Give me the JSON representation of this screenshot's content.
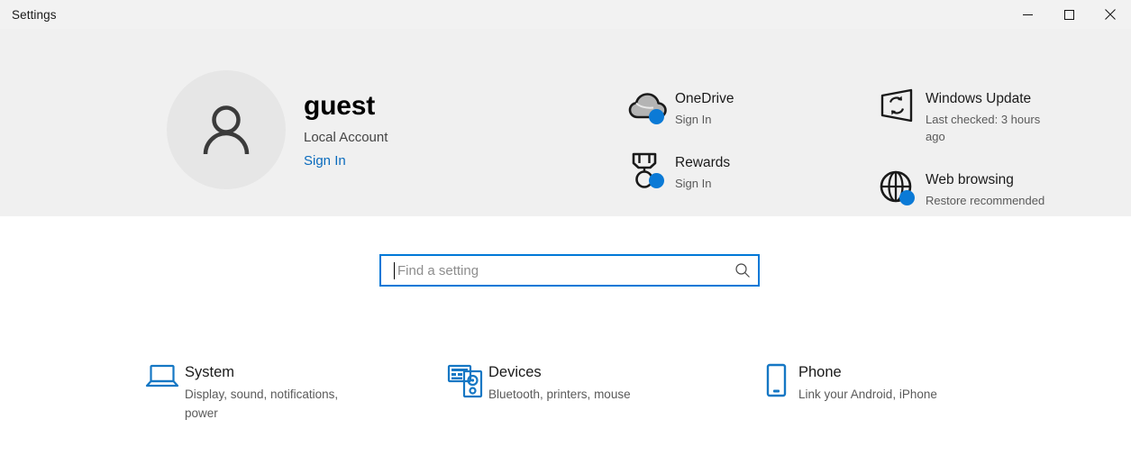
{
  "window": {
    "title": "Settings",
    "controls": [
      {
        "name": "minimize",
        "glyph": "minimize-icon"
      },
      {
        "name": "maximize",
        "glyph": "maximize-icon"
      },
      {
        "name": "close",
        "glyph": "close-icon"
      }
    ]
  },
  "account": {
    "avatar_icon": "person-icon",
    "name": "guest",
    "type": "Local Account",
    "sign_in_label": "Sign In"
  },
  "status_columns": [
    {
      "items": [
        {
          "icon": "onedrive-cloud-icon",
          "title": "OneDrive",
          "subtitle": "Sign In"
        },
        {
          "icon": "rewards-medal-icon",
          "title": "Rewards",
          "subtitle": "Sign In"
        }
      ]
    },
    {
      "items": [
        {
          "icon": "windows-update-icon",
          "title": "Windows Update",
          "subtitle": "Last checked: 3 hours ago"
        },
        {
          "icon": "web-browsing-globe-icon",
          "title": "Web browsing",
          "subtitle": "Restore recommended"
        }
      ]
    }
  ],
  "search": {
    "placeholder": "Find a setting",
    "value": "",
    "icon": "search-icon",
    "focused": true
  },
  "categories": [
    {
      "icon": "system-laptop-icon",
      "title": "System",
      "subtitle": "Display, sound, notifications, power"
    },
    {
      "icon": "devices-keyboard-speaker-icon",
      "title": "Devices",
      "subtitle": "Bluetooth, printers, mouse"
    },
    {
      "icon": "phone-icon",
      "title": "Phone",
      "subtitle": "Link your Android, iPhone"
    }
  ],
  "colors": {
    "accent": "#0078d7",
    "link": "#0a6bbd",
    "header_background": "#f0f0f0",
    "badge": "#0b7ad6"
  }
}
